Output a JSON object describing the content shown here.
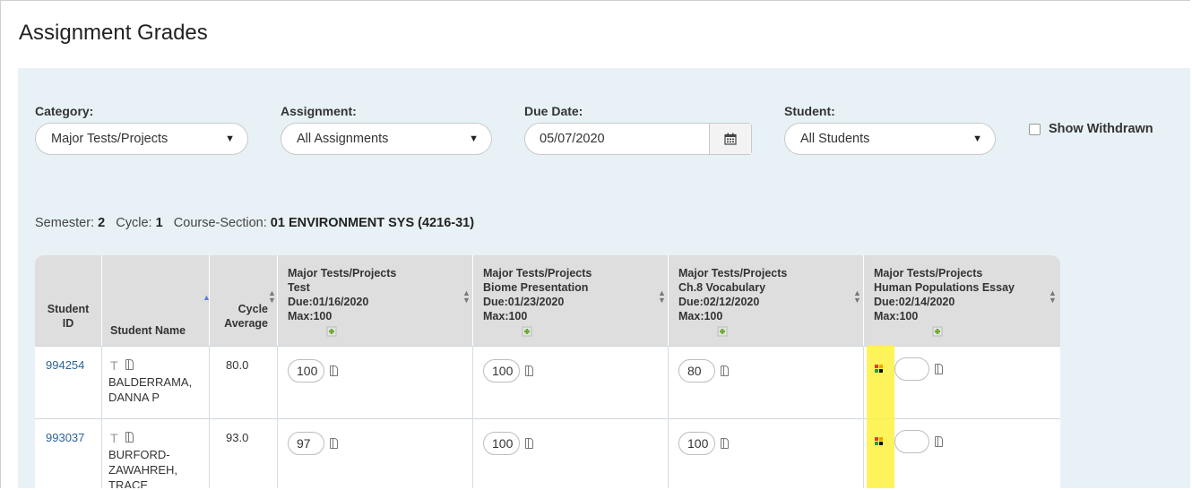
{
  "page": {
    "title": "Assignment Grades"
  },
  "filters": {
    "category": {
      "label": "Category:",
      "value": "Major Tests/Projects"
    },
    "assignment": {
      "label": "Assignment:",
      "value": "All Assignments"
    },
    "due_date": {
      "label": "Due Date:",
      "value": "05/07/2020"
    },
    "student": {
      "label": "Student:",
      "value": "All Students"
    },
    "show_withdrawn": {
      "label": "Show Withdrawn",
      "checked": false
    }
  },
  "info": {
    "semester_label": "Semester:",
    "semester": "2",
    "cycle_label": "Cycle:",
    "cycle": "1",
    "course_label": "Course-Section:",
    "course": "01 ENVIRONMENT SYS (4216-31)"
  },
  "table": {
    "headers": {
      "student_id": [
        "Student",
        "ID"
      ],
      "student_name": "Student Name",
      "cycle_average": [
        "Cycle",
        "Average"
      ]
    },
    "assignments": [
      {
        "category": "Major Tests/Projects",
        "name": "Test",
        "due": "Due:01/16/2020",
        "max": "Max:100"
      },
      {
        "category": "Major Tests/Projects",
        "name": "Biome Presentation",
        "due": "Due:01/23/2020",
        "max": "Max:100"
      },
      {
        "category": "Major Tests/Projects",
        "name": "Ch.8 Vocabulary",
        "due": "Due:02/12/2020",
        "max": "Max:100"
      },
      {
        "category": "Major Tests/Projects",
        "name": "Human Populations Essay",
        "due": "Due:02/14/2020",
        "max": "Max:100"
      }
    ],
    "rows": [
      {
        "id": "994254",
        "flag": "T",
        "name_lines": [
          "BALDERRAMA,",
          "DANNA P"
        ],
        "average": "80.0",
        "grades": [
          "100",
          "100",
          "80",
          ""
        ]
      },
      {
        "id": "993037",
        "flag": "T",
        "name_lines": [
          "BURFORD-",
          "ZAWAHREH,",
          "TRACE"
        ],
        "average": "93.0",
        "grades": [
          "97",
          "100",
          "100",
          ""
        ]
      }
    ]
  },
  "colors": {
    "panel": "#e8f2f6",
    "header": "#dedede",
    "link": "#2a6496",
    "highlight": "#fdf23f"
  }
}
